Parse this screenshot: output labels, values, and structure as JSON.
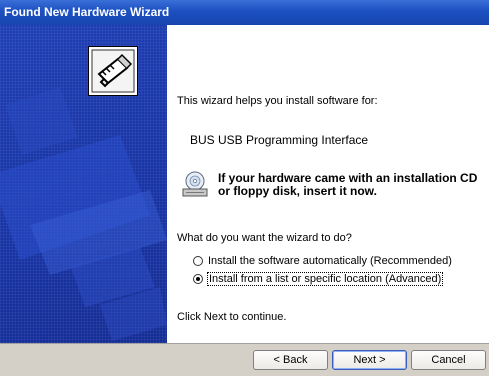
{
  "window": {
    "title": "Found New Hardware Wizard"
  },
  "content": {
    "intro": "This wizard helps you install software for:",
    "device_name": "BUS USB Programming Interface",
    "cd_note_line1": "If your hardware came with an installation CD",
    "cd_note_line2": "or floppy disk, insert it now.",
    "question": "What do you want the wizard to do?",
    "options": [
      {
        "label": "Install the software automatically (Recommended)",
        "selected": false
      },
      {
        "label": "Install from a list or specific location (Advanced)",
        "selected": true
      }
    ],
    "footer": "Click Next to continue."
  },
  "buttons": {
    "back": "< Back",
    "next": "Next >",
    "cancel": "Cancel"
  },
  "colors": {
    "title_bar": "#1c4fc0",
    "side_panel": "#1834a5",
    "button_bar": "#d4d0c8"
  },
  "icons": {
    "wizard": "hardware-card-icon",
    "cd": "cd-drive-icon"
  }
}
